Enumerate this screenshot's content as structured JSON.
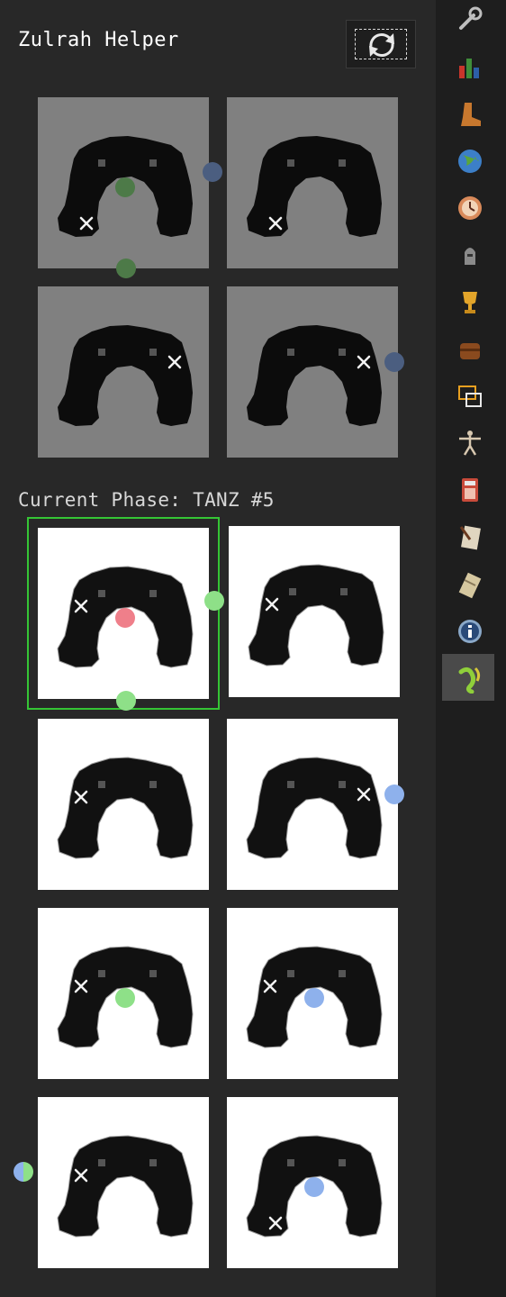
{
  "plugin": {
    "title": "Zulrah Helper",
    "reset_icon": "refresh-icon"
  },
  "phase": {
    "label": "Current Phase: TANZ #5"
  },
  "colors": {
    "panel_bg": "#282828",
    "sidebar_bg": "#1e1e1e",
    "grey_tile": "#808080",
    "white_tile": "#ffffff",
    "highlight": "#35c535",
    "green": "#8ee088",
    "blue": "#8eb1ec",
    "red": "#ef7f8a",
    "dim_green": "#4d7a48",
    "dim_blue": "#4b5e80"
  },
  "overview_tiles": [
    {
      "zulrah": "center",
      "color": "green",
      "player": "south-west"
    },
    {
      "zulrah": "west",
      "color": "blue",
      "player": "south-west"
    },
    {
      "zulrah": "north",
      "color": "green",
      "player": "east"
    },
    {
      "zulrah": "east",
      "color": "blue",
      "player": "east"
    }
  ],
  "rotation_tiles": [
    {
      "zulrah": "center",
      "color": "red",
      "player": "west",
      "current": true
    },
    {
      "zulrah": "west",
      "color": "green",
      "player": "west",
      "current": false
    },
    {
      "zulrah": "north",
      "color": "green",
      "player": "west",
      "current": false
    },
    {
      "zulrah": "east",
      "color": "blue",
      "player": "east",
      "current": false
    },
    {
      "zulrah": "center",
      "color": "green",
      "player": "west",
      "current": false
    },
    {
      "zulrah": "center",
      "color": "blue",
      "player": "west",
      "current": false
    },
    {
      "zulrah": "west",
      "color": "jad",
      "player": "west",
      "current": false
    },
    {
      "zulrah": "center",
      "color": "blue",
      "player": "south-west",
      "current": false
    }
  ],
  "sidebar_icons": [
    "wrench-icon",
    "bar-chart-icon",
    "boot-icon",
    "globe-icon",
    "clock-icon",
    "helmet-icon",
    "trophy-icon",
    "chest-icon",
    "window-icon",
    "figure-icon",
    "calculator-icon",
    "notes-icon",
    "scroll-icon",
    "info-icon",
    "zulrah-snake-icon"
  ],
  "active_sidebar_icon": "zulrah-snake-icon"
}
